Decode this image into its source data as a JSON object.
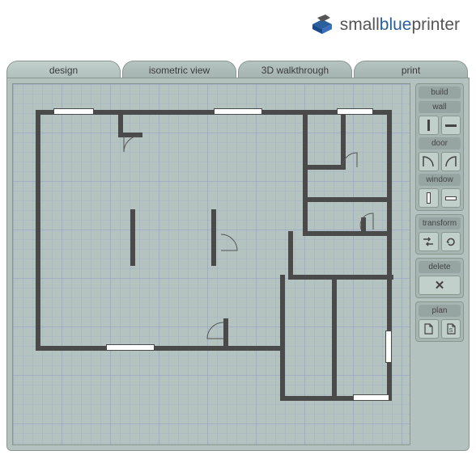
{
  "logo": {
    "part1": "small",
    "part2": "blue",
    "part3": "printer"
  },
  "tabs": [
    {
      "label": "design",
      "active": true
    },
    {
      "label": "isometric view",
      "active": false
    },
    {
      "label": "3D walkthrough",
      "active": false
    },
    {
      "label": "print",
      "active": false
    }
  ],
  "toolbox": {
    "build_header": "build",
    "wall_header": "wall",
    "door_header": "door",
    "window_header": "window",
    "transform_header": "transform",
    "delete_header": "delete",
    "plan_header": "plan"
  }
}
